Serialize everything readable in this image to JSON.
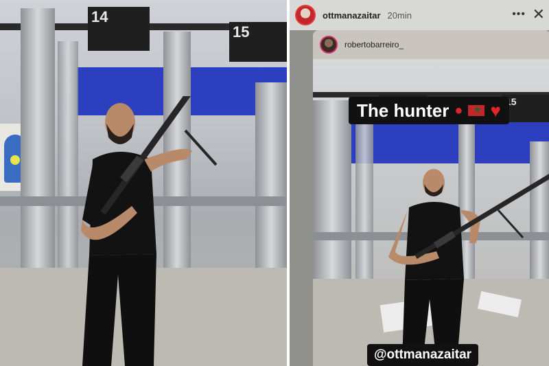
{
  "left_photo": {
    "lane_sign_left": "14",
    "lane_sign_right": "15"
  },
  "story": {
    "username": "ottmanazaitar",
    "time": "20min",
    "more_icon": "ellipsis-icon",
    "close_icon": "close-icon",
    "repost": {
      "username": "robertobarreiro_",
      "lane_sign": "15",
      "caption": "The hunter",
      "caption_emojis": [
        "boxing-glove-icon",
        "morocco-flag-icon",
        "heart-icon"
      ],
      "mention": "@ottmanazaitar"
    }
  },
  "colors": {
    "story_bg": "#8f8f8c",
    "caption_bg": "#111111",
    "avatar_ring": "#e33a3a",
    "range_wall_blue": "#2b3fbf"
  }
}
